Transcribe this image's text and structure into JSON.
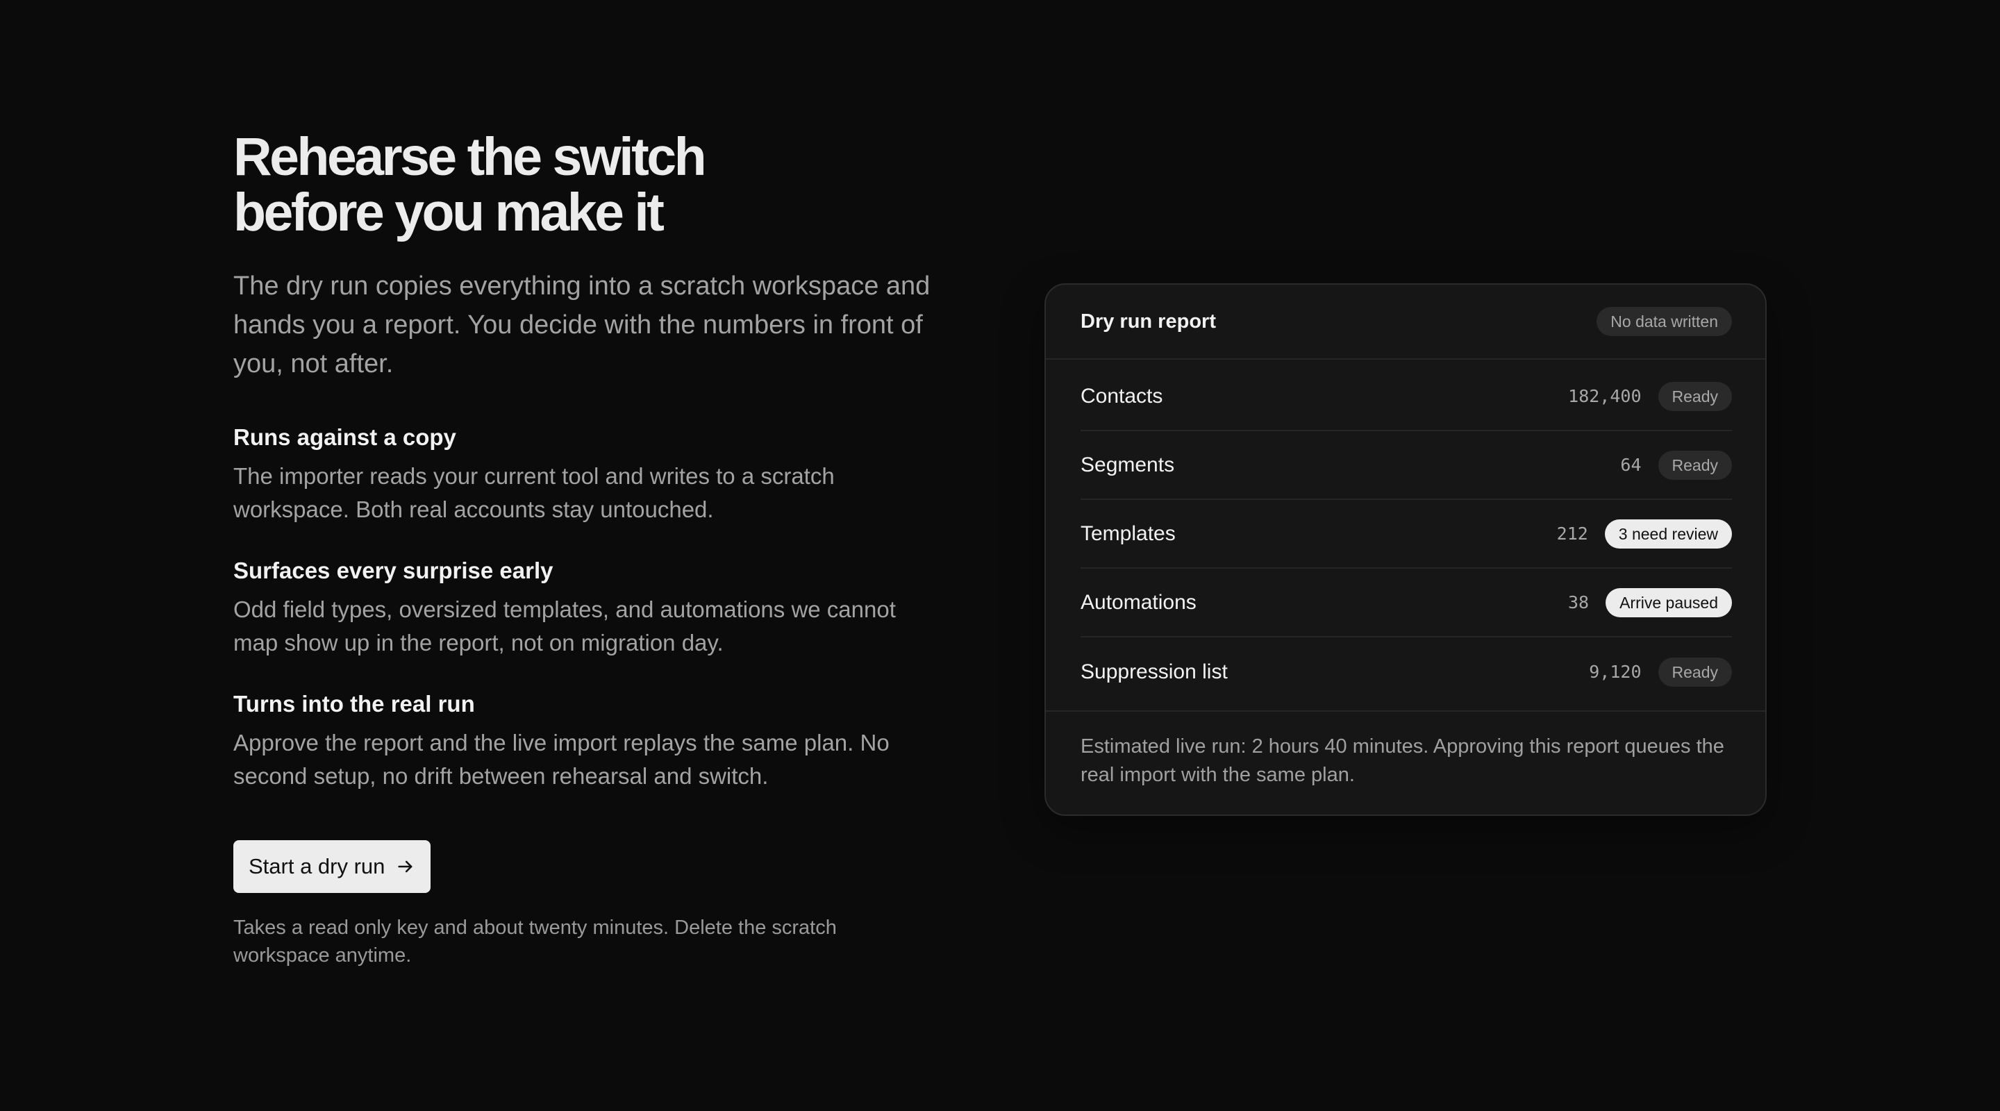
{
  "hero": {
    "headline_line1": "Rehearse the switch",
    "headline_line2": "before you make it",
    "lead": "The dry run copies everything into a scratch workspace and hands you a report. You decide with the numbers in front of you, not after."
  },
  "features": [
    {
      "title": "Runs against a copy",
      "body": "The importer reads your current tool and writes to a scratch workspace. Both real accounts stay untouched."
    },
    {
      "title": "Surfaces every surprise early",
      "body": "Odd field types, oversized templates, and automations we cannot map show up in the report, not on migration day."
    },
    {
      "title": "Turns into the real run",
      "body": "Approve the report and the live import replays the same plan. No second setup, no drift between rehearsal and switch."
    }
  ],
  "cta": {
    "label": "Start a dry run",
    "icon": "arrow-right-icon"
  },
  "note": "Takes a read only key and about twenty minutes. Delete the scratch workspace anytime.",
  "report": {
    "title": "Dry run report",
    "status_badge": "No data written",
    "rows": [
      {
        "label": "Contacts",
        "count": "182,400",
        "status": "Ready",
        "highlight": false
      },
      {
        "label": "Segments",
        "count": "64",
        "status": "Ready",
        "highlight": false
      },
      {
        "label": "Templates",
        "count": "212",
        "status": "3 need review",
        "highlight": true
      },
      {
        "label": "Automations",
        "count": "38",
        "status": "Arrive paused",
        "highlight": true
      },
      {
        "label": "Suppression list",
        "count": "9,120",
        "status": "Ready",
        "highlight": false
      }
    ],
    "footer": "Estimated live run: 2 hours 40 minutes. Approving this report queues the real import with the same plan."
  },
  "colors": {
    "background": "#0b0b0b",
    "card": "#161616",
    "highlight_badge": "#ececec",
    "neutral_badge": "#2a2a2a"
  }
}
